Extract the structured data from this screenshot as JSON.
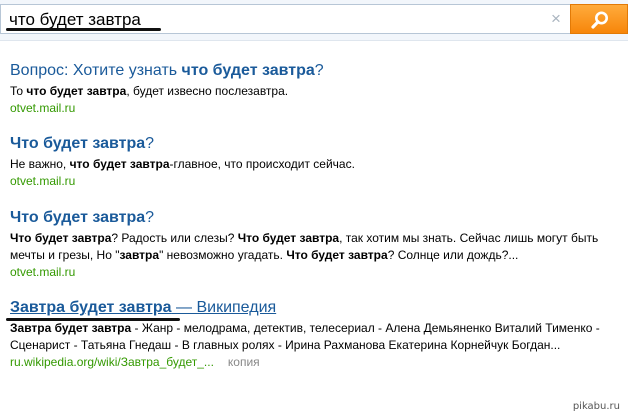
{
  "search": {
    "query": "что будет завтра",
    "clear_symbol": "×"
  },
  "results": [
    {
      "title_pre": "Вопрос: Хотите узнать ",
      "title_bold": "что будет завтра",
      "title_post": "?",
      "snippet": [
        {
          "t": "То ",
          "b": false
        },
        {
          "t": "что будет завтра",
          "b": true
        },
        {
          "t": ", будет извесно послезавтра.",
          "b": false
        }
      ],
      "url": "otvet.mail.ru"
    },
    {
      "title_pre": "",
      "title_bold": "Что будет завтра",
      "title_post": "?",
      "snippet": [
        {
          "t": "Не важно, ",
          "b": false
        },
        {
          "t": "что будет завтра",
          "b": true
        },
        {
          "t": "-главное, что происходит сейчас.",
          "b": false
        }
      ],
      "url": "otvet.mail.ru"
    },
    {
      "title_pre": "",
      "title_bold": "Что будет завтра",
      "title_post": "?",
      "snippet": [
        {
          "t": "Что будет завтра",
          "b": true
        },
        {
          "t": "? Радость или слезы? ",
          "b": false
        },
        {
          "t": "Что будет завтра",
          "b": true
        },
        {
          "t": ", так хотим мы знать. Сейчас лишь могут быть мечты и грезы, Но \"",
          "b": false
        },
        {
          "t": "завтра",
          "b": true
        },
        {
          "t": "\" невозможно угадать. ",
          "b": false
        },
        {
          "t": "Что будет завтра",
          "b": true
        },
        {
          "t": "? Солнце или дождь?...",
          "b": false
        }
      ],
      "url": "otvet.mail.ru"
    },
    {
      "title_bold": "Завтра будет завтра",
      "title_post": " — Википедия",
      "snippet": [
        {
          "t": "Завтра будет завтра",
          "b": true
        },
        {
          "t": " - Жанр - мелодрама, детектив, телесериал - Алена Демьяненко Виталий Тименко - Сценарист - Татьяна Гнедаш - В главных ролях - Ирина Рахманова Екатерина Корнейчук Богдан...",
          "b": false
        }
      ],
      "url": "ru.wikipedia.org/wiki/Завтра_будет_...",
      "copy_label": "копия"
    }
  ],
  "watermark": "pikabu.ru",
  "colors": {
    "link": "#1a5a9a",
    "url": "#339900",
    "search_button": "#f7860a"
  }
}
